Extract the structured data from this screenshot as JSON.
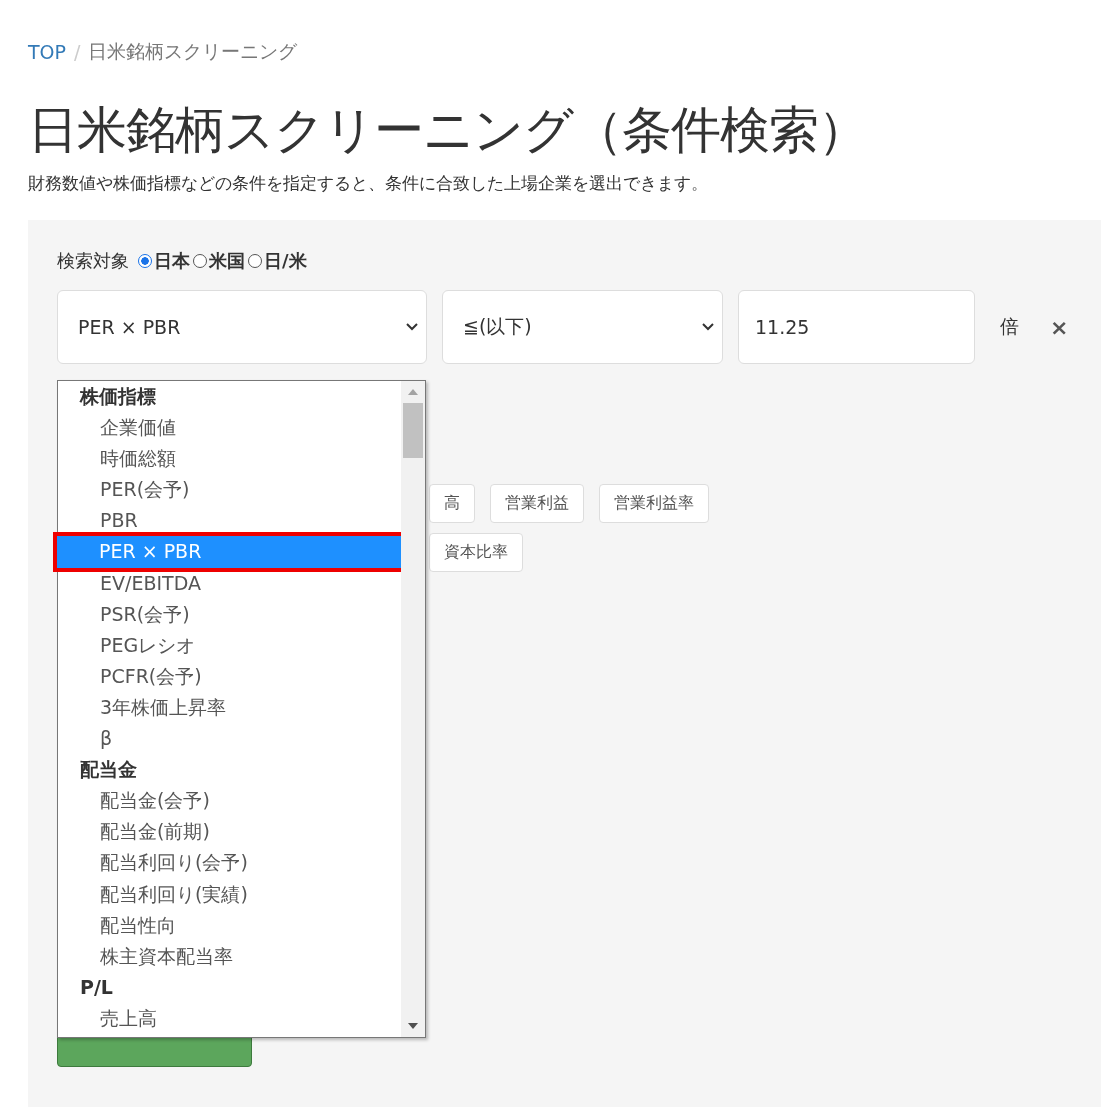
{
  "breadcrumb": {
    "separator": "/",
    "items": [
      {
        "label": "TOP",
        "current": false
      },
      {
        "label": "日米銘柄スクリーニング",
        "current": true
      }
    ]
  },
  "title": "日米銘柄スクリーニング（条件検索）",
  "description": "財務数値や株価指標などの条件を指定すると、条件に合致した上場企業を選出できます。",
  "search_target": {
    "label": "検索対象",
    "options": [
      {
        "label": "日本",
        "selected": true
      },
      {
        "label": "米国",
        "selected": false
      },
      {
        "label": "日/米",
        "selected": false
      }
    ]
  },
  "condition": {
    "metric": "PER × PBR",
    "operator": "≦(以下)",
    "value": "11.25",
    "unit": "倍",
    "remove": "×"
  },
  "chips": [
    [
      "高",
      "営業利益",
      "営業利益率"
    ],
    [
      "資本比率"
    ]
  ],
  "dropdown": {
    "groups": [
      {
        "label": "株価指標",
        "options": [
          {
            "label": "企業価値",
            "selected": false,
            "outlined": false
          },
          {
            "label": "時価総額",
            "selected": false,
            "outlined": false
          },
          {
            "label": "PER(会予)",
            "selected": false,
            "outlined": false
          },
          {
            "label": "PBR",
            "selected": false,
            "outlined": false
          },
          {
            "label": "PER × PBR",
            "selected": true,
            "outlined": true
          },
          {
            "label": "EV/EBITDA",
            "selected": false,
            "outlined": false
          },
          {
            "label": "PSR(会予)",
            "selected": false,
            "outlined": false
          },
          {
            "label": "PEGレシオ",
            "selected": false,
            "outlined": false
          },
          {
            "label": "PCFR(会予)",
            "selected": false,
            "outlined": false
          },
          {
            "label": "3年株価上昇率",
            "selected": false,
            "outlined": false
          },
          {
            "label": "β",
            "selected": false,
            "outlined": false
          }
        ]
      },
      {
        "label": "配当金",
        "options": [
          {
            "label": "配当金(会予)",
            "selected": false,
            "outlined": false
          },
          {
            "label": "配当金(前期)",
            "selected": false,
            "outlined": false
          },
          {
            "label": "配当利回り(会予)",
            "selected": false,
            "outlined": false
          },
          {
            "label": "配当利回り(実績)",
            "selected": false,
            "outlined": false
          },
          {
            "label": "配当性向",
            "selected": false,
            "outlined": false
          },
          {
            "label": "株主資本配当率",
            "selected": false,
            "outlined": false
          }
        ]
      },
      {
        "label": "P/L",
        "options": [
          {
            "label": "売上高",
            "selected": false,
            "outlined": false
          }
        ]
      }
    ]
  }
}
